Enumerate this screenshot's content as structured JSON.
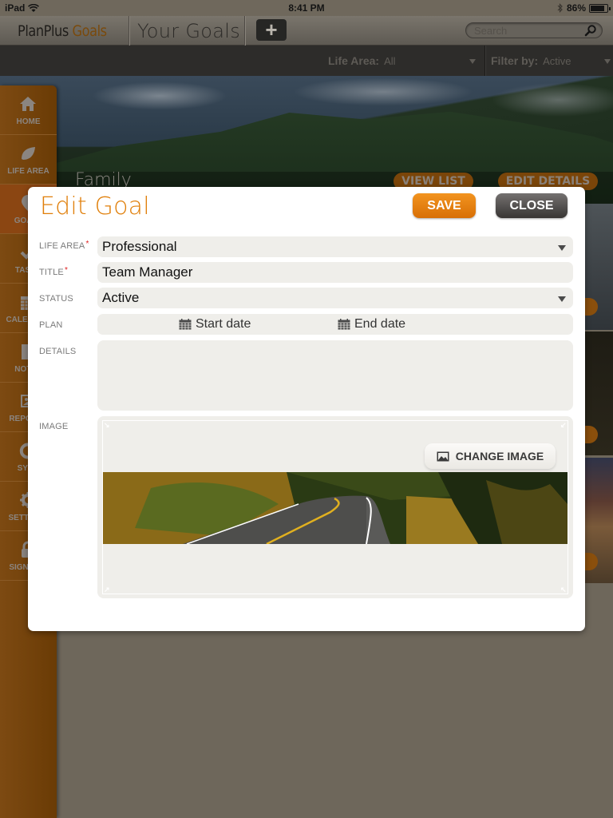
{
  "status_bar": {
    "device": "iPad",
    "time": "8:41 PM",
    "battery_percent": "86%",
    "battery_level": 0.86
  },
  "header": {
    "brand_primary": "PlanPlus",
    "brand_accent": "Goals",
    "page_title": "Your Goals",
    "add_label": "+",
    "search_placeholder": "Search"
  },
  "filters": {
    "life_area_label": "Life Area:",
    "life_area_value": "All",
    "filter_by_label": "Filter by:",
    "filter_by_value": "Active"
  },
  "banner": {
    "title": "Family",
    "view_list_label": "VIEW LIST",
    "edit_details_label": "EDIT DETAILS"
  },
  "sidebar": {
    "items": [
      {
        "label": "HOME",
        "icon": "home-icon"
      },
      {
        "label": "LIFE AREA",
        "icon": "leaf-icon"
      },
      {
        "label": "GOALS",
        "icon": "map-pin-icon"
      },
      {
        "label": "TASKS",
        "icon": "check-icon"
      },
      {
        "label": "CALENDAR",
        "icon": "calendar-icon"
      },
      {
        "label": "NOTES",
        "icon": "note-icon"
      },
      {
        "label": "REPORTS",
        "icon": "image-icon"
      },
      {
        "label": "SYNC",
        "icon": "sync-icon"
      },
      {
        "label": "SETTINGS",
        "icon": "gear-icon"
      },
      {
        "label": "SIGN OUT",
        "icon": "lock-icon"
      }
    ]
  },
  "modal": {
    "title": "Edit Goal",
    "save_label": "SAVE",
    "close_label": "CLOSE",
    "fields": {
      "life_area": {
        "label": "LIFE AREA",
        "required": "*",
        "value": "Professional"
      },
      "title": {
        "label": "TITLE",
        "required": "*",
        "value": "Team Manager"
      },
      "status": {
        "label": "STATUS",
        "value": "Active"
      },
      "plan": {
        "label": "PLAN",
        "start_label": "Start date",
        "end_label": "End date"
      },
      "details": {
        "label": "DETAILS",
        "value": ""
      },
      "image": {
        "label": "IMAGE",
        "change_label": "CHANGE IMAGE"
      }
    }
  },
  "colors": {
    "accent_orange": "#e07f0a",
    "save_button": "#f2941f",
    "close_button": "#474443",
    "sidebar": "#7d4a12",
    "required_star": "#e02020"
  }
}
